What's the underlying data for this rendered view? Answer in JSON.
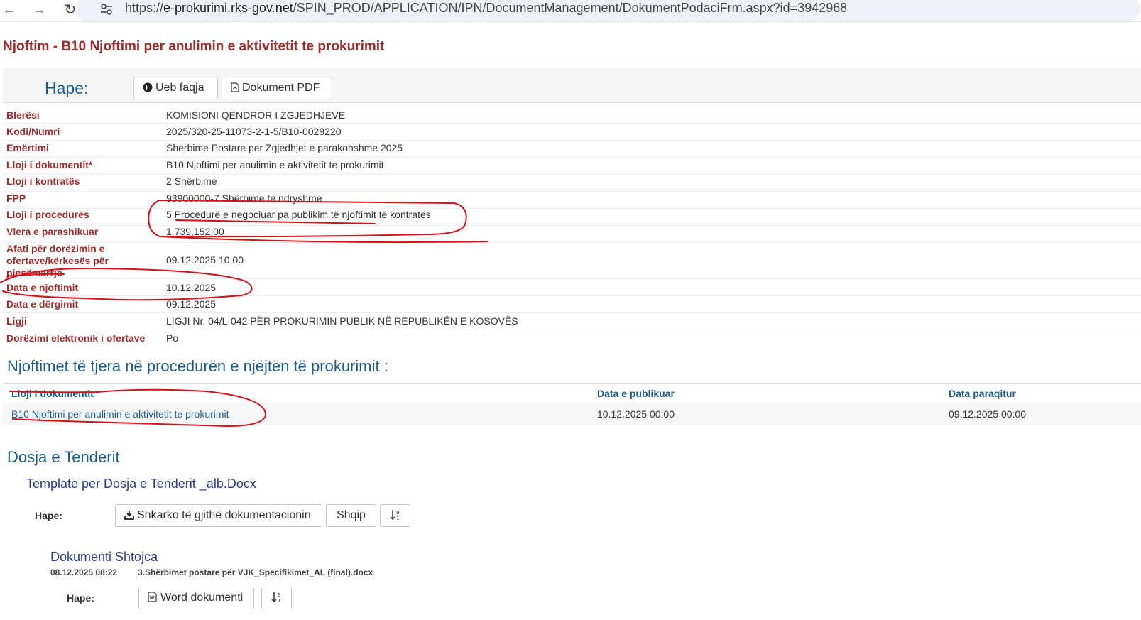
{
  "browser": {
    "url_prefix": "https://",
    "url_domain": "e-prokurimi.rks-gov.net",
    "url_path": "/SPIN_PROD/APPLICATION/IPN/DocumentManagement/DokumentPodaciFrm.aspx?id=3942968"
  },
  "page": {
    "title": "Njoftim - B10 Njoftimi per anulimin e aktivitetit te prokurimit"
  },
  "open_bar": {
    "label": "Hape:",
    "web_button": "Ueb faqja",
    "pdf_button": "Dokument PDF"
  },
  "details": [
    {
      "label": "Blerësi",
      "value": "KOMISIONI QENDROR I ZGJEDHJEVE"
    },
    {
      "label": "Kodi/Numri",
      "value": "2025/320-25-11073-2-1-5/B10-0029220"
    },
    {
      "label": "Emërtimi",
      "value": "Shërbime Postare per Zgjedhjet e parakohshme 2025"
    },
    {
      "label": "Lloji i dokumentit*",
      "value": "B10 Njoftimi per anulimin e aktivitetit te prokurimit"
    },
    {
      "label": "Lloji i kontratës",
      "value": "2 Shërbime"
    },
    {
      "label": "FPP",
      "value": "93900000-7 Shërbime te ndryshme"
    },
    {
      "label": "Lloji i procedurës",
      "value": "5 Procedurë e negociuar pa publikim të njoftimit të kontratës"
    },
    {
      "label": "Vlera e parashikuar",
      "value": "1,739,152.00"
    },
    {
      "label": "Afati për dorëzimin e ofertave/kërkesës për pjesëmarrje",
      "value": "09.12.2025 10:00"
    },
    {
      "label": "Data e njoftimit",
      "value": "10.12.2025"
    },
    {
      "label": "Data e dërgimit",
      "value": "09.12.2025"
    },
    {
      "label": "Ligji",
      "value": "LIGJI Nr. 04/L-042 PËR PROKURIMIN PUBLIK NË REPUBLIKËN E KOSOVËS"
    },
    {
      "label": "Dorëzimi elektronik i ofertave",
      "value": "Po"
    }
  ],
  "other_notices": {
    "heading": "Njoftimet të tjera në procedurën e njëjtën të prokurimit :",
    "columns": [
      "Lloji i dokumentit",
      "Data e publikuar",
      "Data paraqitur"
    ],
    "rows": [
      {
        "doc": "B10 Njoftimi per anulimin e aktivitetit te prokurimit",
        "published": "10.12.2025 00:00",
        "submitted": "09.12.2025 00:00"
      }
    ]
  },
  "tender": {
    "heading": "Dosja e Tenderit",
    "template_title": "Template per Dosja e Tenderit _alb.Docx",
    "open_label": "Hape:",
    "download_all": "Shkarko të gjithë dokumentacionin",
    "language": "Shqip",
    "annex_title": "Dokumenti Shtojca",
    "annex_date": "08.12.2025 08:22",
    "annex_file": "3.Shërbimet postare për VJK_Specifikimet_AL (final).docx",
    "annex_open_label": "Hape:",
    "word_button": "Word dokumenti"
  },
  "colors": {
    "label_red": "#a12a2a",
    "heading_blue": "#1c5b8c",
    "annotation_red": "#d8101a"
  }
}
